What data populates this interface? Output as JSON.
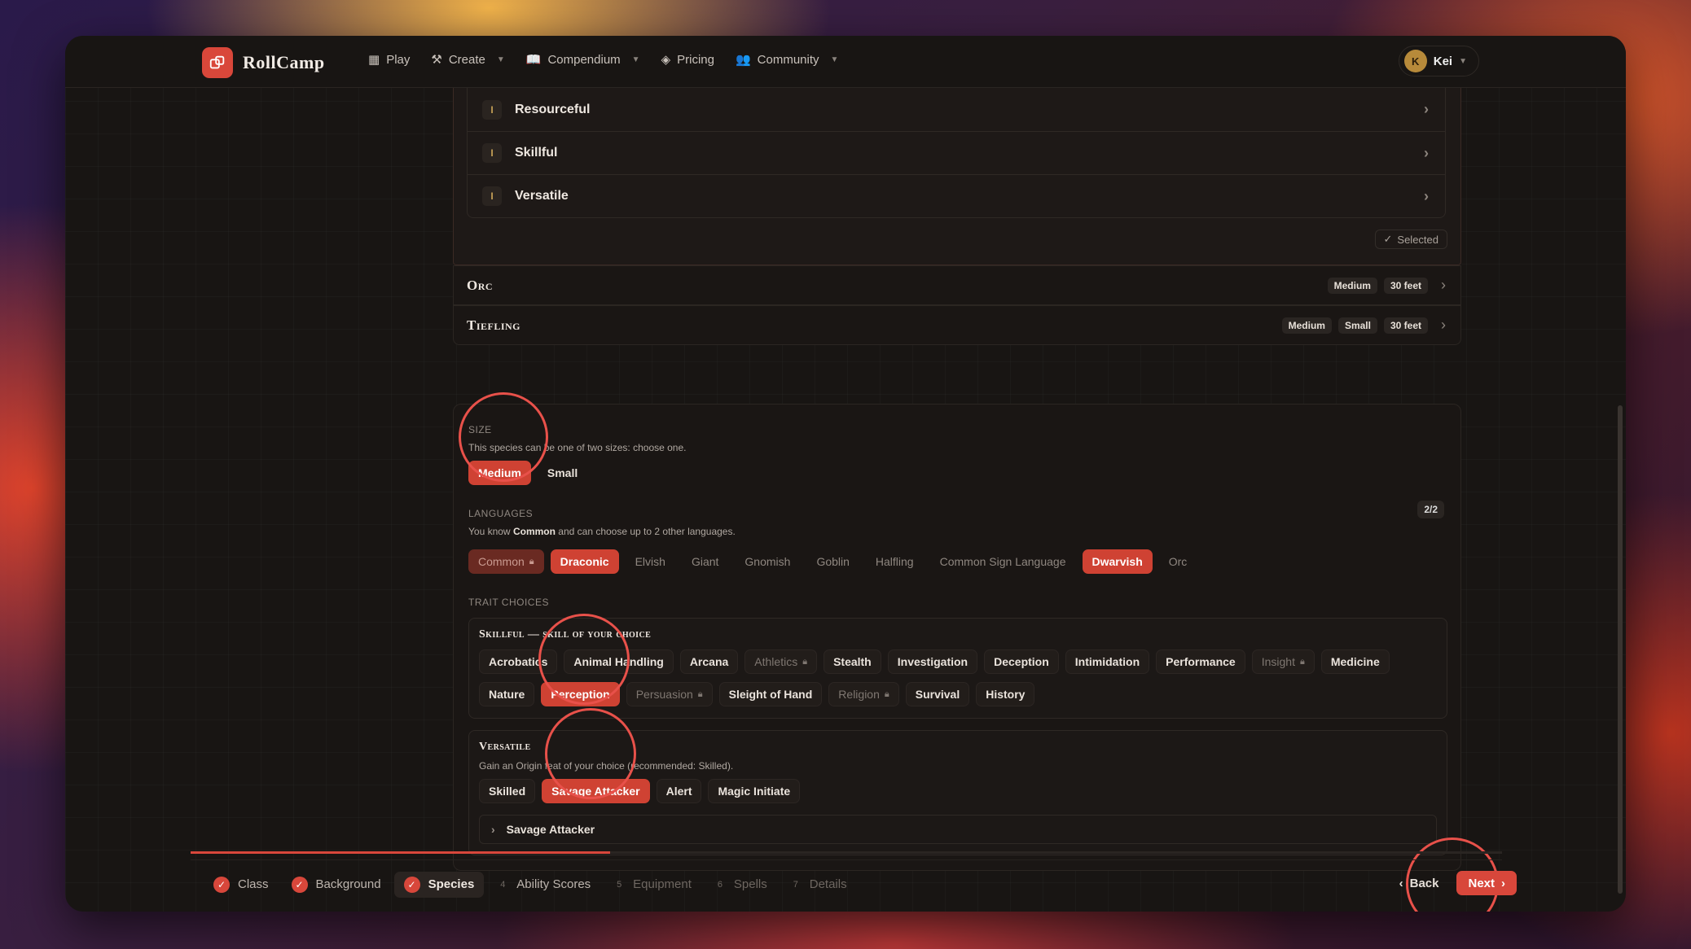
{
  "app": {
    "brand": "RollCamp"
  },
  "nav": {
    "play": "Play",
    "create": "Create",
    "compendium": "Compendium",
    "pricing": "Pricing",
    "community": "Community"
  },
  "user": {
    "initial": "K",
    "name": "Kei"
  },
  "feats": [
    {
      "badge": "I",
      "name": "Resourceful"
    },
    {
      "badge": "I",
      "name": "Skillful"
    },
    {
      "badge": "I",
      "name": "Versatile"
    }
  ],
  "selected_label": "Selected",
  "species": [
    {
      "name": "Orc",
      "tags": [
        "Medium",
        "30 feet"
      ]
    },
    {
      "name": "Tiefling",
      "tags": [
        "Medium",
        "Small",
        "30 feet"
      ]
    }
  ],
  "size": {
    "label": "Size",
    "desc": "This species can be one of two sizes: choose one.",
    "options": [
      "Medium",
      "Small"
    ],
    "selected": "Medium"
  },
  "languages": {
    "label": "Languages",
    "counter": "2/2",
    "desc_prefix": "You know",
    "desc_known": "Common",
    "desc_suffix": "and can choose up to 2 other languages.",
    "options": [
      "Common",
      "Draconic",
      "Elvish",
      "Giant",
      "Gnomish",
      "Goblin",
      "Halfling",
      "Common Sign Language",
      "Dwarvish",
      "Orc"
    ]
  },
  "trait_choices": {
    "label": "Trait Choices",
    "skillful": {
      "title": "Skillful — skill of your choice",
      "row1": [
        "Acrobatics",
        "Animal Handling",
        "Arcana",
        "Athletics",
        "Stealth",
        "Investigation",
        "Deception",
        "Intimidation",
        "Performance",
        "Insight",
        "Medicine"
      ],
      "row2": [
        "Nature",
        "Perception",
        "Persuasion",
        "Sleight of Hand",
        "Religion",
        "Survival",
        "History"
      ],
      "selected": "Perception"
    },
    "versatile": {
      "title": "Versatile",
      "desc": "Gain an Origin feat of your choice (recommended: Skilled).",
      "options": [
        "Skilled",
        "Savage Attacker",
        "Alert",
        "Magic Initiate"
      ],
      "selected": "Savage Attacker",
      "expander": "Savage Attacker"
    }
  },
  "progress": {
    "fraction": 0.32
  },
  "steps": [
    {
      "num": "1",
      "label": "Class",
      "state": "done"
    },
    {
      "num": "2",
      "label": "Background",
      "state": "done"
    },
    {
      "num": "3",
      "label": "Species",
      "state": "current"
    },
    {
      "num": "4",
      "label": "Ability Scores",
      "state": "next"
    },
    {
      "num": "5",
      "label": "Equipment",
      "state": "pending"
    },
    {
      "num": "6",
      "label": "Spells",
      "state": "pending"
    },
    {
      "num": "7",
      "label": "Details",
      "state": "pending"
    }
  ],
  "buttons": {
    "back": "Back",
    "next": "Next"
  },
  "colors": {
    "accent": "#d8473b",
    "background": "#181513"
  }
}
